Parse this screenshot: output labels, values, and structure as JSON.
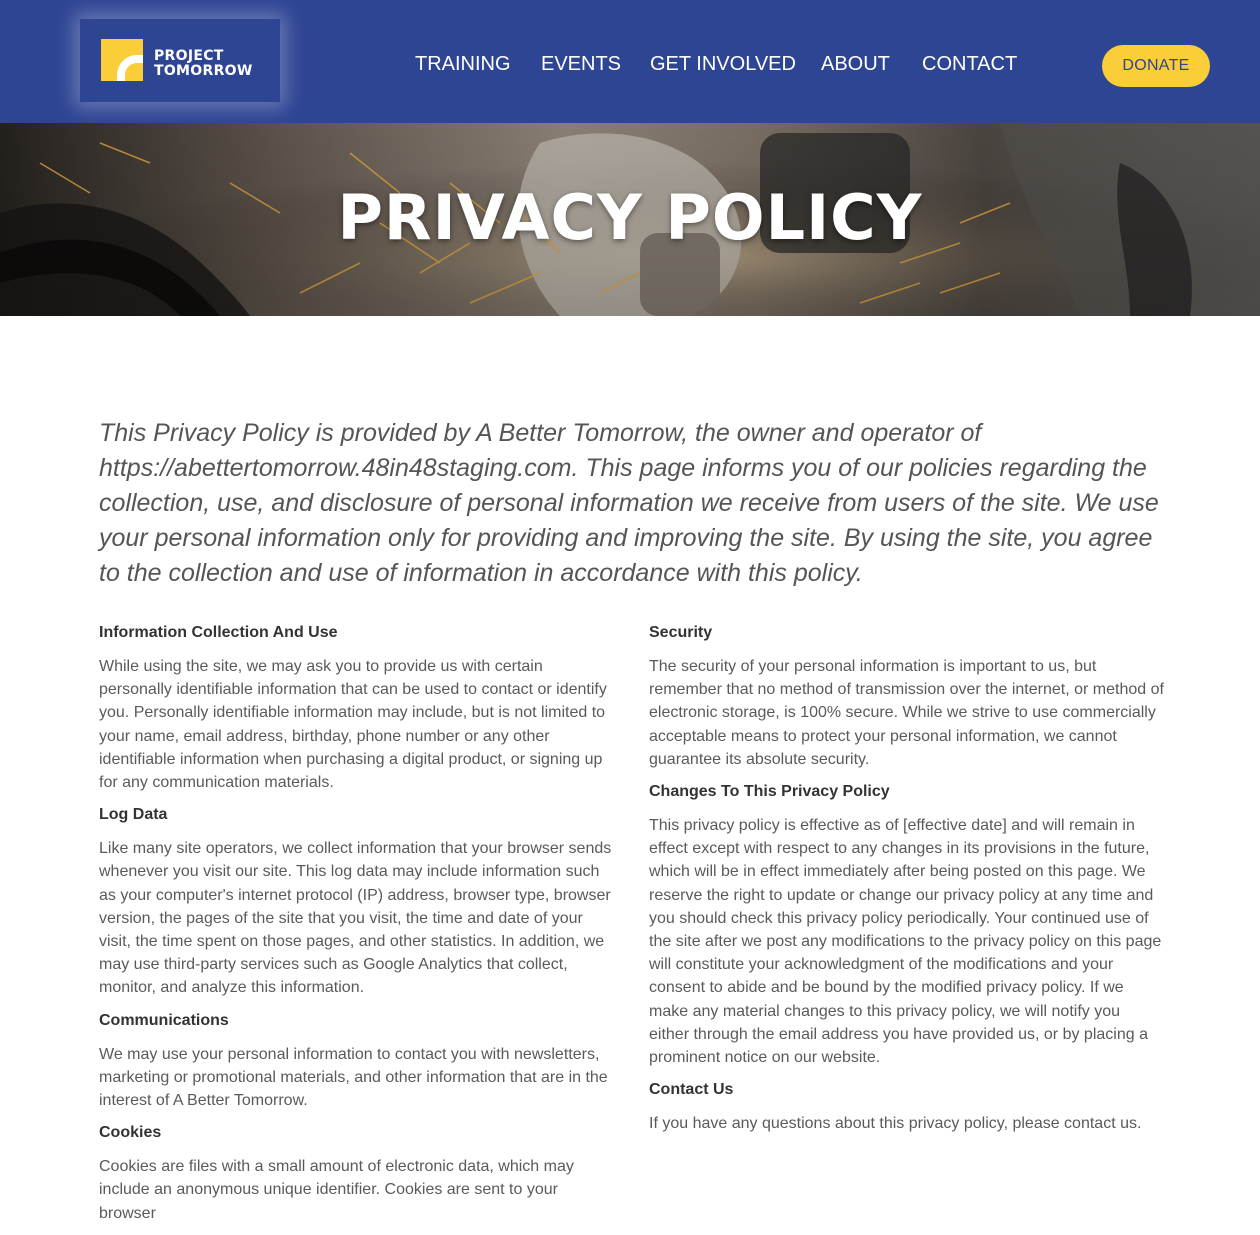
{
  "header": {
    "logo": {
      "line1": "PROJECT",
      "line2": "TOMORROW"
    },
    "nav": [
      {
        "label": "TRAINING"
      },
      {
        "label": "EVENTS"
      },
      {
        "label": "GET INVOLVED"
      },
      {
        "label": "ABOUT"
      },
      {
        "label": "CONTACT"
      }
    ],
    "donate_label": "DONATE"
  },
  "hero": {
    "title": "PRIVACY POLICY"
  },
  "intro": "This Privacy Policy is provided by A Better Tomorrow, the owner and operator of https://abettertomorrow.48in48staging.com. This page informs you of our policies regarding the collection, use, and disclosure of personal information we receive from users of the site. We use your personal information only for providing and improving the site. By using the site, you agree to the collection and use of information in accordance with this policy.",
  "sections_left": [
    {
      "heading": "Information Collection And Use",
      "body": "While using the site, we may ask you to provide us with certain personally identifiable information that can be used to contact or identify you. Personally identifiable information may include, but is not limited to your name, email address, birthday, phone number or any other identifiable information when purchasing a digital product, or signing up for any communication materials."
    },
    {
      "heading": "Log Data",
      "body": "Like many site operators, we collect information that your browser sends whenever you visit our site. This log data may include information such as your computer's internet protocol (IP) address, browser type, browser version, the pages of the site that you visit, the time and date of your visit, the time spent on those pages, and other statistics. In addition, we may use third-party services such as Google Analytics that collect, monitor, and analyze this information."
    },
    {
      "heading": "Communications",
      "body": "We may use your personal information to contact you with newsletters, marketing or promotional materials, and other information that are in the interest of A Better Tomorrow."
    },
    {
      "heading": "Cookies",
      "body": "Cookies are files with a small amount of electronic data, which may include an anonymous unique identifier. Cookies are sent to your browser"
    }
  ],
  "sections_right": [
    {
      "heading": "Security",
      "body": "The security of your personal information is important to us, but remember that no method of transmission over the internet, or method of electronic storage, is 100% secure. While we strive to use commercially acceptable means to protect your personal information, we cannot guarantee its absolute security."
    },
    {
      "heading": "Changes To This Privacy Policy",
      "body": "This privacy policy is effective as of [effective date] and will remain in effect except with respect to any changes in its provisions in the future, which will be in effect immediately after being posted on this page. We reserve the right to update or change our privacy policy at any time and you should check this privacy policy periodically. Your continued use of the site after we post any modifications to the privacy policy on this page will constitute your acknowledgment of the modifications and your consent to abide and be bound by the modified privacy policy. If we make any material changes to this privacy policy, we will notify you either through the email address you have provided us, or by placing a prominent notice on our website."
    },
    {
      "heading": "Contact Us",
      "body": "If you have any questions about this privacy policy, please contact us."
    }
  ],
  "colors": {
    "header_bg": "#2e4594",
    "accent_yellow": "#fbcd38"
  }
}
